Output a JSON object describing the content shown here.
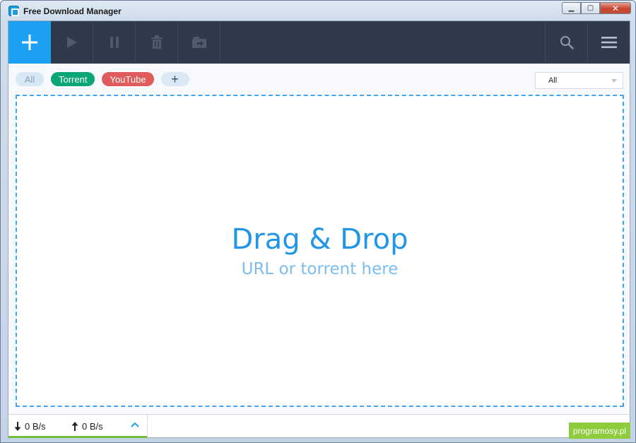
{
  "window": {
    "title": "Free Download Manager",
    "controls": {
      "minimize": "▁",
      "maximize": "▢",
      "close": "✕"
    }
  },
  "toolbar": {
    "buttons": [
      {
        "icon": "plus-icon"
      },
      {
        "icon": "play-icon"
      },
      {
        "icon": "pause-icon"
      },
      {
        "icon": "trash-icon"
      },
      {
        "icon": "move-to-folder-icon"
      }
    ],
    "right_buttons": [
      {
        "icon": "search-icon"
      },
      {
        "icon": "hamburger-menu-icon"
      }
    ]
  },
  "tags": {
    "all": "All",
    "torrent": "Torrent",
    "youtube": "YouTube",
    "add": "+"
  },
  "filter": {
    "selected": "All"
  },
  "dropzone": {
    "title": "Drag & Drop",
    "subtitle": "URL or torrent here"
  },
  "status": {
    "download_speed": "0 B/s",
    "upload_speed": "0 B/s"
  },
  "watermark": "programosy.pl",
  "colors": {
    "toolbar_bg": "#2f3a4c",
    "accent": "#1ca0f2",
    "torrent_tag": "#0aa676",
    "youtube_tag": "#e05b5b",
    "dropzone_border": "#42a5f0",
    "status_bar_indicator": "#6fc13e"
  }
}
